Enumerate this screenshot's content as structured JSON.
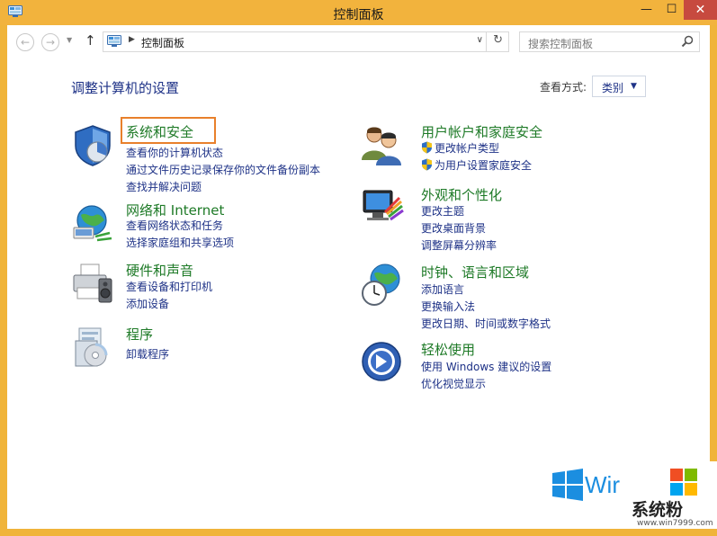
{
  "window": {
    "title": "控制面板"
  },
  "caption": {
    "minimize": "—",
    "maximize": "☐",
    "close": "✕"
  },
  "nav": {
    "back": "←",
    "forward": "→",
    "recent": "▼",
    "up": "↑",
    "address": {
      "separator": "▶",
      "path": "控制面板",
      "dropdown": "∨",
      "refresh": "↻"
    },
    "search": {
      "placeholder": "搜索控制面板"
    }
  },
  "main": {
    "heading": "调整计算机的设置",
    "view_by_label": "查看方式:",
    "view_by_value": "类别",
    "view_by_arrow": "▼"
  },
  "categories": {
    "system": {
      "title": "系统和安全",
      "links": [
        "查看你的计算机状态",
        "通过文件历史记录保存你的文件备份副本",
        "查找并解决问题"
      ]
    },
    "network": {
      "title": "网络和 Internet",
      "links": [
        "查看网络状态和任务",
        "选择家庭组和共享选项"
      ]
    },
    "hardware": {
      "title": "硬件和声音",
      "links": [
        "查看设备和打印机",
        "添加设备"
      ]
    },
    "programs": {
      "title": "程序",
      "links": [
        "卸载程序"
      ]
    },
    "users": {
      "title": "用户帐户和家庭安全",
      "links": [
        "更改帐户类型",
        "为用户设置家庭安全"
      ]
    },
    "appearance": {
      "title": "外观和个性化",
      "links": [
        "更改主题",
        "更改桌面背景",
        "调整屏幕分辨率"
      ]
    },
    "clock": {
      "title": "时钟、语言和区域",
      "links": [
        "添加语言",
        "更换输入法",
        "更改日期、时间或数字格式"
      ]
    },
    "ease": {
      "title": "轻松使用",
      "links": [
        "使用 Windows 建议的设置",
        "优化视觉显示"
      ]
    }
  },
  "watermark": {
    "win": "Wir",
    "brand": "系统粉",
    "site": "www.win7999.com"
  },
  "colors": {
    "titlebar": "#f2b33d",
    "category_title": "#1e7a27",
    "link": "#1e3287",
    "highlight": "#e8802b",
    "close": "#c74a3f"
  }
}
